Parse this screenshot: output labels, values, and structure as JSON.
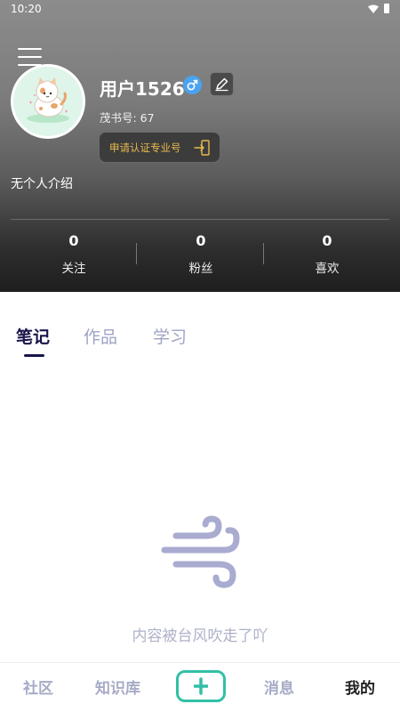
{
  "status_bar": {
    "time": "10:20"
  },
  "profile": {
    "username": "用户1526",
    "user_id": "茂书号: 67",
    "cert_button_label": "申请认证专业号",
    "bio": "无个人介绍"
  },
  "stats": [
    {
      "value": "0",
      "label": "关注"
    },
    {
      "value": "0",
      "label": "粉丝"
    },
    {
      "value": "0",
      "label": "喜欢"
    }
  ],
  "tabs": [
    {
      "label": "笔记",
      "active": true
    },
    {
      "label": "作品",
      "active": false
    },
    {
      "label": "学习",
      "active": false
    }
  ],
  "empty_state": {
    "text": "内容被台风吹走了吖",
    "icon": "wind-icon"
  },
  "bottom_nav": [
    {
      "label": "社区",
      "active": false
    },
    {
      "label": "知识库",
      "active": false
    },
    {
      "label": "消息",
      "active": false
    },
    {
      "label": "我的",
      "active": true
    }
  ],
  "colors": {
    "accent_dark": "#18154a",
    "muted_text": "#9ea3c4",
    "cert_gold": "#e7b94e",
    "add_button_green": "#32bfa6",
    "gender_blue": "#4aa3f0"
  }
}
